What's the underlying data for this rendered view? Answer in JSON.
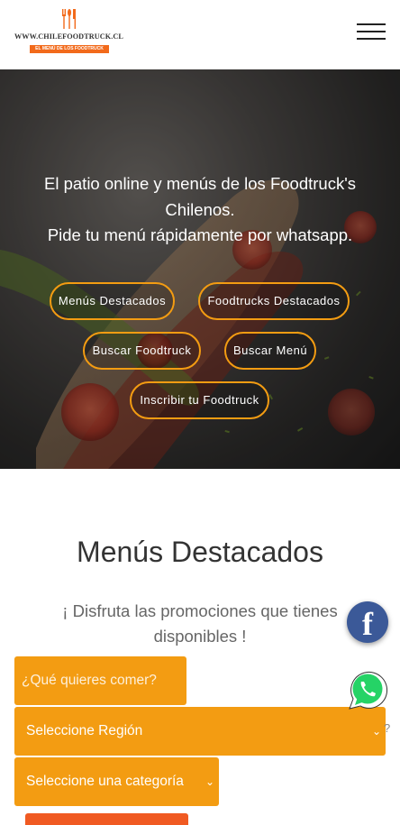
{
  "header": {
    "logo_text": "WWW.CHILEFOODTRUCK.CL",
    "logo_tagline": "EL MENÚ DE LOS FOODTRUCK"
  },
  "hero": {
    "line1": "El patio online y menús de los Foodtruck's Chilenos.",
    "line2": "Pide tu menú rápidamente por whatsapp.",
    "buttons": [
      "Menús Destacados",
      "Foodtrucks Destacados",
      "Buscar Foodtruck",
      "Buscar Menú",
      "Inscribir tu Foodtruck"
    ]
  },
  "featured": {
    "title": "Menús Destacados",
    "subtitle": "¡ Disfruta las promociones que tienes disponibles !"
  },
  "search": {
    "placeholder": "¿Qué quieres comer?",
    "region_selected": "Seleccione Región",
    "category_selected": "Seleccione una categoría",
    "stray_text": "?"
  },
  "colors": {
    "accent": "#f39c12",
    "button": "#f05a22",
    "facebook": "#3b5998",
    "whatsapp": "#25d366"
  },
  "icons": {
    "logo": "fork-knife-icon",
    "menu": "hamburger-menu-icon",
    "facebook": "facebook-icon",
    "whatsapp": "whatsapp-icon",
    "select": "chevron-down-icon"
  }
}
